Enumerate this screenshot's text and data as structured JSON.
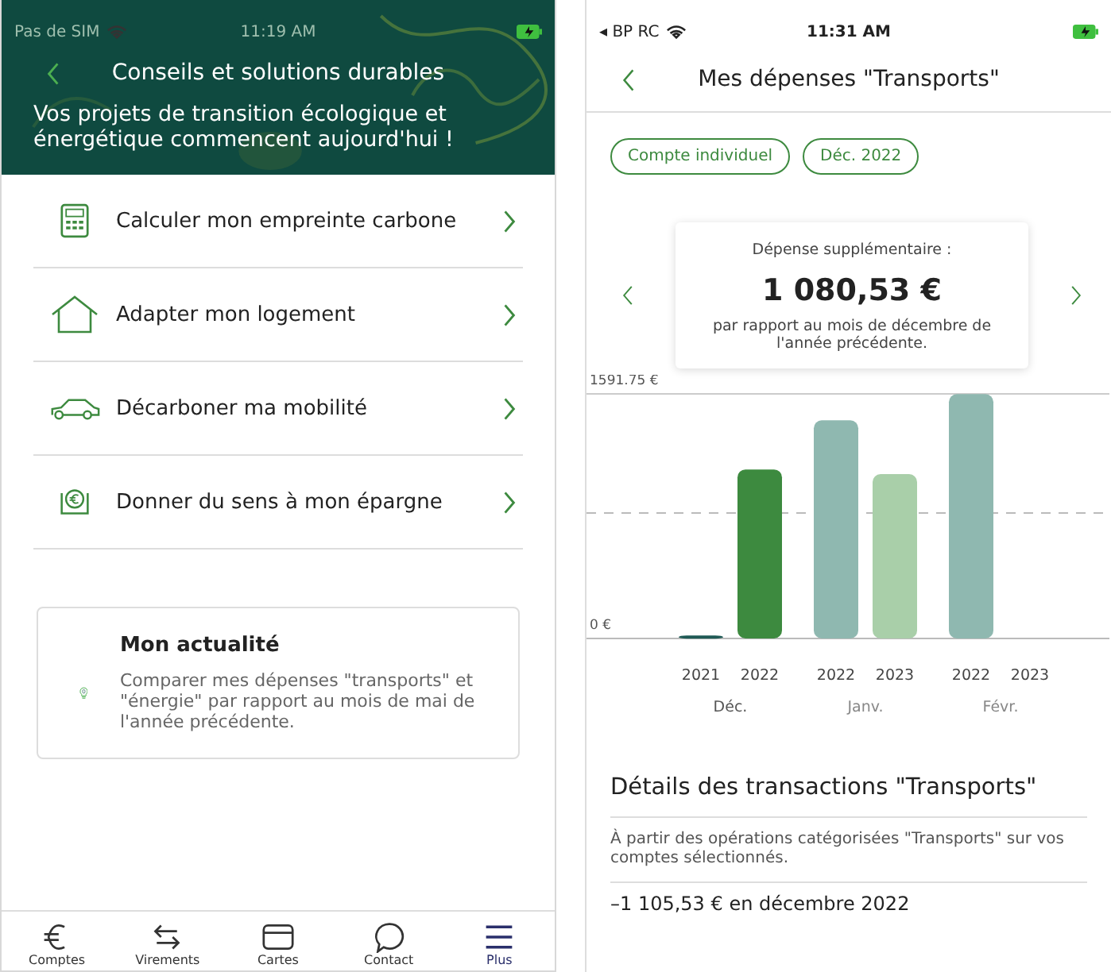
{
  "left_screen": {
    "status_bar": {
      "carrier": "Pas de SIM",
      "time": "11:19 AM"
    },
    "title": "Conseils et solutions durables",
    "subtitle": "Vos projets de transition écologique et énergétique commencent aujourd'hui !",
    "menu_items": [
      {
        "label": "Calculer mon empreinte carbone",
        "kind": "calculator"
      },
      {
        "label": "Adapter mon logement",
        "kind": "house"
      },
      {
        "label": "Décarboner ma mobilité",
        "kind": "car"
      },
      {
        "label": "Donner du sens à mon épargne",
        "kind": "savings"
      }
    ],
    "news_card": {
      "title": "Mon actualité",
      "text": "Comparer mes dépenses \"transports\" et \"énergie\" par rapport au mois de mai de l'année précédente."
    },
    "tab_bar": [
      {
        "label": "Comptes",
        "kind": "euro",
        "selected": false
      },
      {
        "label": "Virements",
        "kind": "transfer",
        "selected": false
      },
      {
        "label": "Cartes",
        "kind": "card",
        "selected": false
      },
      {
        "label": "Contact",
        "kind": "chat",
        "selected": false
      },
      {
        "label": "Plus",
        "kind": "menu",
        "selected": true
      }
    ]
  },
  "right_screen": {
    "status_bar": {
      "carrier": "◂ BP RC",
      "time": "11:31 AM"
    },
    "title": "Mes dépenses \"Transports\"",
    "filters": [
      "Compte individuel",
      "Déc. 2022"
    ],
    "summary": {
      "label": "Dépense supplémentaire :",
      "amount": "1 080,53 €",
      "note": "par rapport au mois de décembre de l'année précédente."
    },
    "chart_data": {
      "type": "bar",
      "categories": [
        "2021",
        "2022",
        "2022",
        "2023",
        "2022",
        "2023"
      ],
      "series": [
        {
          "color": "#1f5a55",
          "values": [
            20,
            null,
            null,
            null,
            null,
            null
          ]
        },
        {
          "color": "#3d8a3f",
          "values": [
            null,
            1100,
            null,
            null,
            null,
            null
          ]
        },
        {
          "color": "#8fb8b0",
          "values": [
            null,
            null,
            1420,
            null,
            1590,
            null
          ]
        },
        {
          "color": "#a9cfa9",
          "values": [
            null,
            null,
            null,
            1070,
            null,
            null
          ]
        }
      ],
      "ylim": [
        0,
        1591.75
      ],
      "yticks": [
        {
          "value": 0,
          "label": "0 €"
        },
        {
          "value": 1591.75,
          "label": "1591.75 €"
        }
      ]
    },
    "month_labels": [
      {
        "label": "Déc.",
        "selected": true
      },
      {
        "label": "Janv.",
        "selected": false
      },
      {
        "label": "Févr.",
        "selected": false
      }
    ],
    "details_title": "Détails des transactions \"Transports\"",
    "details_text": "À partir des opérations catégorisées \"Transports\" sur vos comptes sélectionnés.",
    "first_entry": "–1 105,53 € en décembre 2022"
  }
}
